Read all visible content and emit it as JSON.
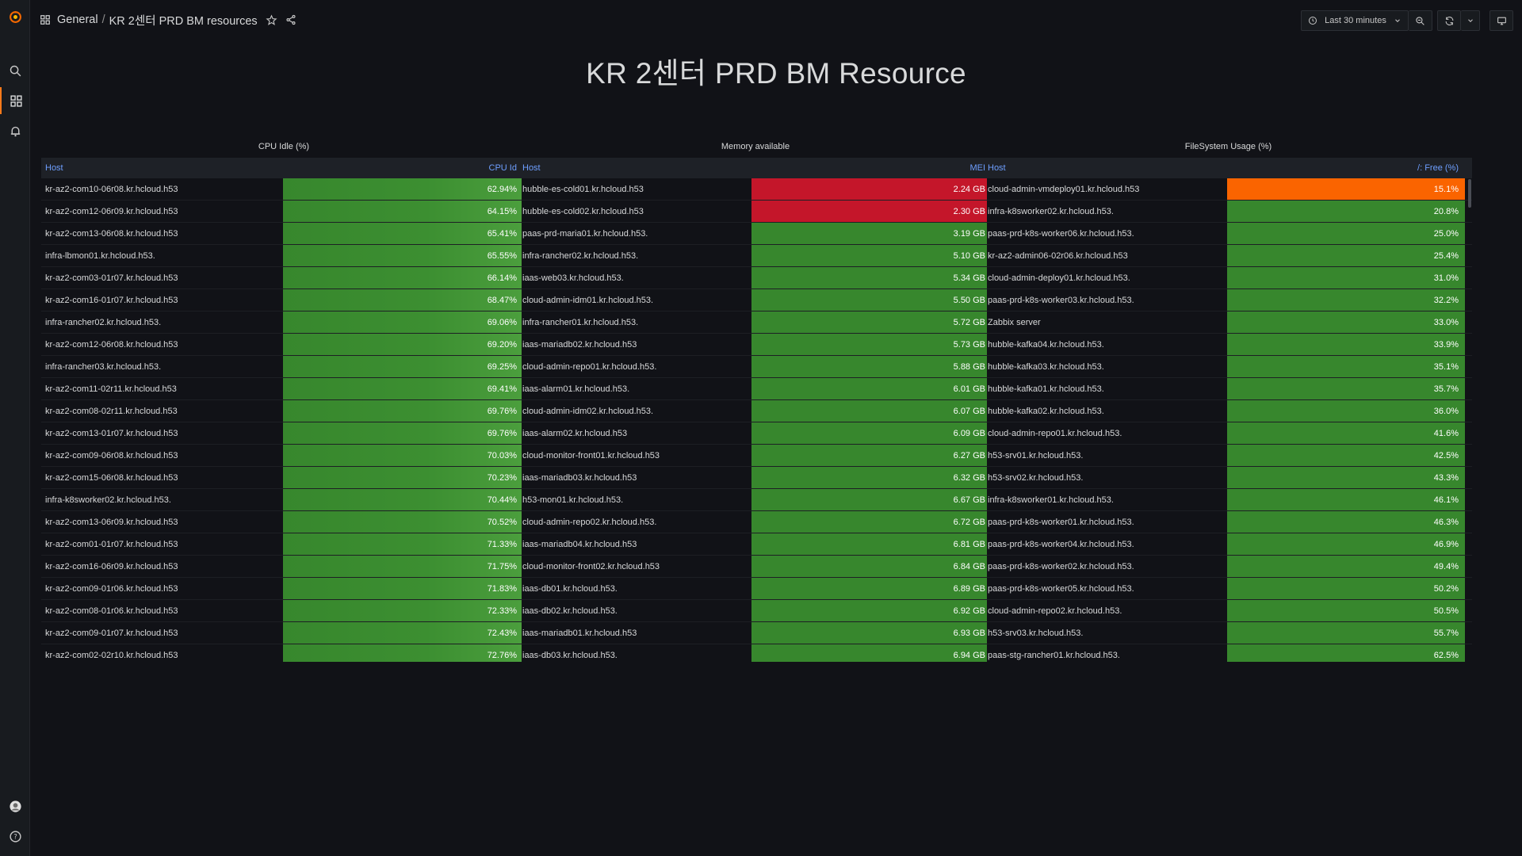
{
  "breadcrumb": {
    "folder": "General",
    "separator": "/",
    "dashboard": "KR 2센터 PRD BM resources"
  },
  "time_picker": {
    "label": "Last 30 minutes"
  },
  "dashboard_title": "KR 2센터 PRD BM Resource",
  "panels": {
    "cpu_title": "CPU Idle (%)",
    "mem_title": "Memory available",
    "fs_title": "FileSystem Usage (%)"
  },
  "headers": {
    "cpu_host": "Host",
    "cpu_value": "CPU Id",
    "mem_host": "Host",
    "mem_value": "MEI",
    "fs_host": "Host",
    "fs_value": "/: Free (%)"
  },
  "colors": {
    "green": "#37872d",
    "red": "#c4162a",
    "orange": "#fa6400",
    "header_link": "#6e9fff",
    "accent": "#ff7a1a"
  },
  "cpu_rows": [
    {
      "host": "kr-az2-com10-06r08.kr.hcloud.h53",
      "value": "62.94%"
    },
    {
      "host": "kr-az2-com12-06r09.kr.hcloud.h53",
      "value": "64.15%"
    },
    {
      "host": "kr-az2-com13-06r08.kr.hcloud.h53",
      "value": "65.41%"
    },
    {
      "host": "infra-lbmon01.kr.hcloud.h53.",
      "value": "65.55%"
    },
    {
      "host": "kr-az2-com03-01r07.kr.hcloud.h53",
      "value": "66.14%"
    },
    {
      "host": "kr-az2-com16-01r07.kr.hcloud.h53",
      "value": "68.47%"
    },
    {
      "host": "infra-rancher02.kr.hcloud.h53.",
      "value": "69.06%"
    },
    {
      "host": "kr-az2-com12-06r08.kr.hcloud.h53",
      "value": "69.20%"
    },
    {
      "host": "infra-rancher03.kr.hcloud.h53.",
      "value": "69.25%"
    },
    {
      "host": "kr-az2-com11-02r11.kr.hcloud.h53",
      "value": "69.41%"
    },
    {
      "host": "kr-az2-com08-02r11.kr.hcloud.h53",
      "value": "69.76%"
    },
    {
      "host": "kr-az2-com13-01r07.kr.hcloud.h53",
      "value": "69.76%"
    },
    {
      "host": "kr-az2-com09-06r08.kr.hcloud.h53",
      "value": "70.03%"
    },
    {
      "host": "kr-az2-com15-06r08.kr.hcloud.h53",
      "value": "70.23%"
    },
    {
      "host": "infra-k8sworker02.kr.hcloud.h53.",
      "value": "70.44%"
    },
    {
      "host": "kr-az2-com13-06r09.kr.hcloud.h53",
      "value": "70.52%"
    },
    {
      "host": "kr-az2-com01-01r07.kr.hcloud.h53",
      "value": "71.33%"
    },
    {
      "host": "kr-az2-com16-06r09.kr.hcloud.h53",
      "value": "71.75%"
    },
    {
      "host": "kr-az2-com09-01r06.kr.hcloud.h53",
      "value": "71.83%"
    },
    {
      "host": "kr-az2-com08-01r06.kr.hcloud.h53",
      "value": "72.33%"
    },
    {
      "host": "kr-az2-com09-01r07.kr.hcloud.h53",
      "value": "72.43%"
    },
    {
      "host": "kr-az2-com02-02r10.kr.hcloud.h53",
      "value": "72.76%"
    }
  ],
  "mem_rows": [
    {
      "host": "hubble-es-cold01.kr.hcloud.h53",
      "value": "2.24 GB",
      "color": "red"
    },
    {
      "host": "hubble-es-cold02.kr.hcloud.h53",
      "value": "2.30 GB",
      "color": "red"
    },
    {
      "host": "paas-prd-maria01.kr.hcloud.h53.",
      "value": "3.19 GB",
      "color": "green"
    },
    {
      "host": "infra-rancher02.kr.hcloud.h53.",
      "value": "5.10 GB",
      "color": "green"
    },
    {
      "host": "iaas-web03.kr.hcloud.h53.",
      "value": "5.34 GB",
      "color": "green"
    },
    {
      "host": "cloud-admin-idm01.kr.hcloud.h53.",
      "value": "5.50 GB",
      "color": "green"
    },
    {
      "host": "infra-rancher01.kr.hcloud.h53.",
      "value": "5.72 GB",
      "color": "green"
    },
    {
      "host": "iaas-mariadb02.kr.hcloud.h53",
      "value": "5.73 GB",
      "color": "green"
    },
    {
      "host": "cloud-admin-repo01.kr.hcloud.h53.",
      "value": "5.88 GB",
      "color": "green"
    },
    {
      "host": "iaas-alarm01.kr.hcloud.h53.",
      "value": "6.01 GB",
      "color": "green"
    },
    {
      "host": "cloud-admin-idm02.kr.hcloud.h53.",
      "value": "6.07 GB",
      "color": "green"
    },
    {
      "host": "iaas-alarm02.kr.hcloud.h53",
      "value": "6.09 GB",
      "color": "green"
    },
    {
      "host": "cloud-monitor-front01.kr.hcloud.h53",
      "value": "6.27 GB",
      "color": "green"
    },
    {
      "host": "iaas-mariadb03.kr.hcloud.h53",
      "value": "6.32 GB",
      "color": "green"
    },
    {
      "host": "h53-mon01.kr.hcloud.h53.",
      "value": "6.67 GB",
      "color": "green"
    },
    {
      "host": "cloud-admin-repo02.kr.hcloud.h53.",
      "value": "6.72 GB",
      "color": "green"
    },
    {
      "host": "iaas-mariadb04.kr.hcloud.h53",
      "value": "6.81 GB",
      "color": "green"
    },
    {
      "host": "cloud-monitor-front02.kr.hcloud.h53",
      "value": "6.84 GB",
      "color": "green"
    },
    {
      "host": "iaas-db01.kr.hcloud.h53.",
      "value": "6.89 GB",
      "color": "green"
    },
    {
      "host": "iaas-db02.kr.hcloud.h53.",
      "value": "6.92 GB",
      "color": "green"
    },
    {
      "host": "iaas-mariadb01.kr.hcloud.h53",
      "value": "6.93 GB",
      "color": "green"
    },
    {
      "host": "iaas-db03.kr.hcloud.h53.",
      "value": "6.94 GB",
      "color": "green"
    }
  ],
  "fs_rows": [
    {
      "host": "cloud-admin-vmdeploy01.kr.hcloud.h53",
      "value": "15.1%",
      "color": "orange"
    },
    {
      "host": "infra-k8sworker02.kr.hcloud.h53.",
      "value": "20.8%",
      "color": "green"
    },
    {
      "host": "paas-prd-k8s-worker06.kr.hcloud.h53.",
      "value": "25.0%",
      "color": "green"
    },
    {
      "host": "kr-az2-admin06-02r06.kr.hcloud.h53",
      "value": "25.4%",
      "color": "green"
    },
    {
      "host": "cloud-admin-deploy01.kr.hcloud.h53.",
      "value": "31.0%",
      "color": "green"
    },
    {
      "host": "paas-prd-k8s-worker03.kr.hcloud.h53.",
      "value": "32.2%",
      "color": "green"
    },
    {
      "host": "Zabbix server",
      "value": "33.0%",
      "color": "green"
    },
    {
      "host": "hubble-kafka04.kr.hcloud.h53.",
      "value": "33.9%",
      "color": "green"
    },
    {
      "host": "hubble-kafka03.kr.hcloud.h53.",
      "value": "35.1%",
      "color": "green"
    },
    {
      "host": "hubble-kafka01.kr.hcloud.h53.",
      "value": "35.7%",
      "color": "green"
    },
    {
      "host": "hubble-kafka02.kr.hcloud.h53.",
      "value": "36.0%",
      "color": "green"
    },
    {
      "host": "cloud-admin-repo01.kr.hcloud.h53.",
      "value": "41.6%",
      "color": "green"
    },
    {
      "host": "h53-srv01.kr.hcloud.h53.",
      "value": "42.5%",
      "color": "green"
    },
    {
      "host": "h53-srv02.kr.hcloud.h53.",
      "value": "43.3%",
      "color": "green"
    },
    {
      "host": "infra-k8sworker01.kr.hcloud.h53.",
      "value": "46.1%",
      "color": "green"
    },
    {
      "host": "paas-prd-k8s-worker01.kr.hcloud.h53.",
      "value": "46.3%",
      "color": "green"
    },
    {
      "host": "paas-prd-k8s-worker04.kr.hcloud.h53.",
      "value": "46.9%",
      "color": "green"
    },
    {
      "host": "paas-prd-k8s-worker02.kr.hcloud.h53.",
      "value": "49.4%",
      "color": "green"
    },
    {
      "host": "paas-prd-k8s-worker05.kr.hcloud.h53.",
      "value": "50.2%",
      "color": "green"
    },
    {
      "host": "cloud-admin-repo02.kr.hcloud.h53.",
      "value": "50.5%",
      "color": "green"
    },
    {
      "host": "h53-srv03.kr.hcloud.h53.",
      "value": "55.7%",
      "color": "green"
    },
    {
      "host": "paas-stg-rancher01.kr.hcloud.h53.",
      "value": "62.5%",
      "color": "green"
    }
  ]
}
